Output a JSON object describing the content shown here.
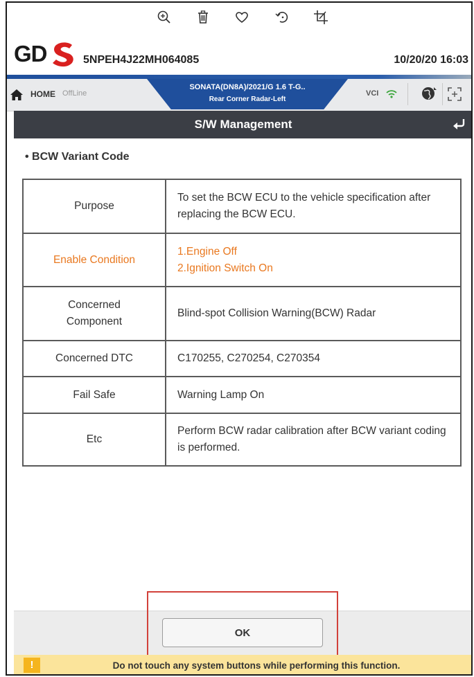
{
  "viewer": {
    "icons": [
      "zoom-in-icon",
      "trash-icon",
      "heart-icon",
      "rotate-icon",
      "crop-icon"
    ]
  },
  "header": {
    "logo_text": "GDS",
    "vin": "5NPEH4J22MH064085",
    "datetime": "10/20/20 16:03"
  },
  "nav": {
    "home_label": "HOME",
    "status": "OffLine",
    "vehicle_line1": "SONATA(DN8A)/2021/G 1.6 T-G..",
    "vehicle_line2": "Rear Corner Radar-Left",
    "vci_label": "VCI"
  },
  "page": {
    "title": "S/W Management",
    "section_label": "• BCW Variant Code"
  },
  "table": {
    "rows": [
      {
        "label": "Purpose",
        "value": "To set the BCW ECU to the vehicle specification after replacing the BCW ECU."
      },
      {
        "label": "Enable Condition",
        "value_lines": [
          "1.Engine Off",
          "2.Ignition Switch On"
        ]
      },
      {
        "label_lines": [
          "Concerned",
          "Component"
        ],
        "value": "Blind-spot Collision Warning(BCW) Radar"
      },
      {
        "label": "Concerned DTC",
        "value": "C170255, C270254, C270354"
      },
      {
        "label": "Fail Safe",
        "value": "Warning Lamp On"
      },
      {
        "label": "Etc",
        "value": "Perform BCW radar calibration after BCW variant coding is performed."
      }
    ]
  },
  "footer": {
    "ok_label": "OK",
    "warning_text": "Do not touch any system buttons while performing this function.",
    "warning_icon_text": "!"
  },
  "colors": {
    "accent_blue": "#1f4f9c",
    "title_bar": "#3b3e45",
    "highlight_orange": "#e9781f",
    "warning_bg": "#fbe49b",
    "annotation_red": "#d2413a",
    "logo_red": "#d9201f"
  }
}
